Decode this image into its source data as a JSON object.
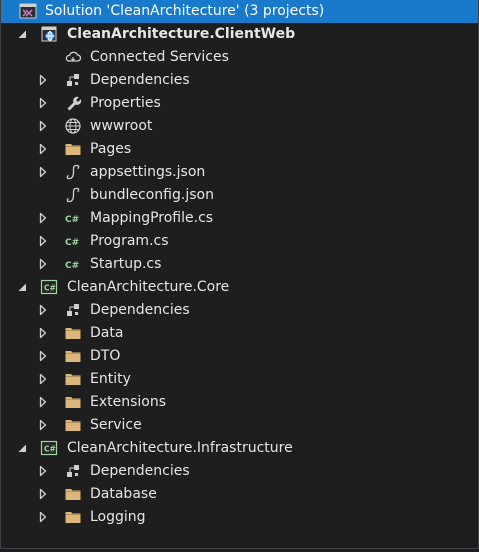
{
  "solution": {
    "label": "Solution 'CleanArchitecture' (3 projects)",
    "icon": "solution-icon"
  },
  "projects": [
    {
      "name": "CleanArchitecture.ClientWeb",
      "icon": "web-project-icon",
      "bold": true,
      "expanded": true,
      "items": [
        {
          "label": "Connected Services",
          "icon": "cloud-icon"
        },
        {
          "label": "Dependencies",
          "icon": "dependencies-icon"
        },
        {
          "label": "Properties",
          "icon": "wrench-icon"
        },
        {
          "label": "wwwroot",
          "icon": "globe-icon"
        },
        {
          "label": "Pages",
          "icon": "folder-icon"
        },
        {
          "label": "appsettings.json",
          "icon": "json-file-icon"
        },
        {
          "label": "bundleconfig.json",
          "icon": "json-file-icon"
        },
        {
          "label": "MappingProfile.cs",
          "icon": "csharp-file-icon"
        },
        {
          "label": "Program.cs",
          "icon": "csharp-file-icon"
        },
        {
          "label": "Startup.cs",
          "icon": "csharp-file-icon"
        }
      ]
    },
    {
      "name": "CleanArchitecture.Core",
      "icon": "csharp-project-icon",
      "bold": false,
      "expanded": true,
      "items": [
        {
          "label": "Dependencies",
          "icon": "dependencies-icon"
        },
        {
          "label": "Data",
          "icon": "folder-icon"
        },
        {
          "label": "DTO",
          "icon": "folder-icon"
        },
        {
          "label": "Entity",
          "icon": "folder-icon"
        },
        {
          "label": "Extensions",
          "icon": "folder-icon"
        },
        {
          "label": "Service",
          "icon": "folder-icon"
        }
      ]
    },
    {
      "name": "CleanArchitecture.Infrastructure",
      "icon": "csharp-project-icon",
      "bold": false,
      "expanded": true,
      "items": [
        {
          "label": "Dependencies",
          "icon": "dependencies-icon"
        },
        {
          "label": "Database",
          "icon": "folder-icon"
        },
        {
          "label": "Logging",
          "icon": "folder-icon"
        }
      ]
    }
  ],
  "expandable_items": [
    "Dependencies",
    "Properties",
    "wwwroot",
    "Pages",
    "appsettings.json",
    "MappingProfile.cs",
    "Program.cs",
    "Startup.cs",
    "Data",
    "DTO",
    "Entity",
    "Extensions",
    "Service",
    "Database",
    "Logging"
  ],
  "colors": {
    "selection": "#1979ca",
    "folder": "#dcb67a",
    "csharp": "#9fd6a3",
    "background": "#1e1e1e"
  }
}
